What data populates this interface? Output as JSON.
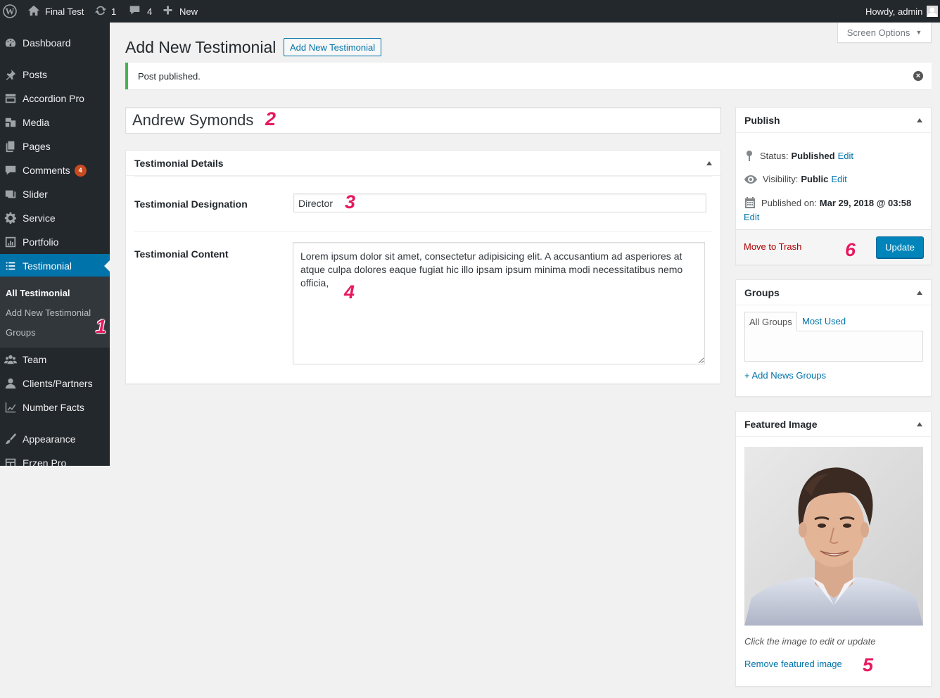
{
  "adminbar": {
    "site_name": "Final Test",
    "updates_count": "1",
    "comments_count": "4",
    "new_label": "New",
    "howdy": "Howdy, admin"
  },
  "sidebar": {
    "items": [
      {
        "label": "Dashboard",
        "icon": "dashboard-icon"
      },
      {
        "label": "Posts",
        "icon": "pin-icon"
      },
      {
        "label": "Accordion Pro",
        "icon": "accordion-icon"
      },
      {
        "label": "Media",
        "icon": "media-icon"
      },
      {
        "label": "Pages",
        "icon": "pages-icon"
      },
      {
        "label": "Comments",
        "icon": "comments-icon",
        "badge": "4"
      },
      {
        "label": "Slider",
        "icon": "slider-icon"
      },
      {
        "label": "Service",
        "icon": "gear-icon"
      },
      {
        "label": "Portfolio",
        "icon": "portfolio-icon"
      },
      {
        "label": "Testimonial",
        "icon": "list-icon"
      },
      {
        "label": "Team",
        "icon": "team-icon"
      },
      {
        "label": "Clients/Partners",
        "icon": "user-icon"
      },
      {
        "label": "Number Facts",
        "icon": "chart-line-icon"
      },
      {
        "label": "Appearance",
        "icon": "brush-icon"
      },
      {
        "label": "Erzen Pro",
        "icon": "layout-icon"
      }
    ],
    "submenu": [
      "All Testimonial",
      "Add New Testimonial",
      "Groups"
    ]
  },
  "header": {
    "screen_options": "Screen Options",
    "page_title": "Add New Testimonial",
    "add_new_button": "Add New Testimonial"
  },
  "notice": {
    "text": "Post published."
  },
  "post": {
    "title": "Andrew Symonds"
  },
  "details": {
    "box_title": "Testimonial Details",
    "designation_label": "Testimonial Designation",
    "designation_value": "Director",
    "content_label": "Testimonial Content",
    "content_value": "Lorem ipsum dolor sit amet, consectetur adipisicing elit. A accusantium ad asperiores at atque culpa dolores eaque fugiat hic illo ipsam ipsum minima modi necessitatibus nemo officia,"
  },
  "publish": {
    "title": "Publish",
    "status_label": "Status:",
    "status_value": "Published",
    "visibility_label": "Visibility:",
    "visibility_value": "Public",
    "published_on_label": "Published on:",
    "published_on_value": "Mar 29, 2018 @ 03:58",
    "edit": "Edit",
    "trash": "Move to Trash",
    "update": "Update"
  },
  "groups": {
    "title": "Groups",
    "tab_all": "All Groups",
    "tab_most_used": "Most Used",
    "add_link": "+ Add News Groups"
  },
  "featured": {
    "title": "Featured Image",
    "hint": "Click the image to edit or update",
    "remove": "Remove featured image"
  },
  "annotations": [
    "1",
    "2",
    "3",
    "4",
    "5",
    "6"
  ],
  "colors": {
    "accent": "#0073aa",
    "button": "#0085ba",
    "success": "#46b450",
    "trash": "#a00",
    "annotation": "#e6195f",
    "badge": "#ca4a1f"
  }
}
